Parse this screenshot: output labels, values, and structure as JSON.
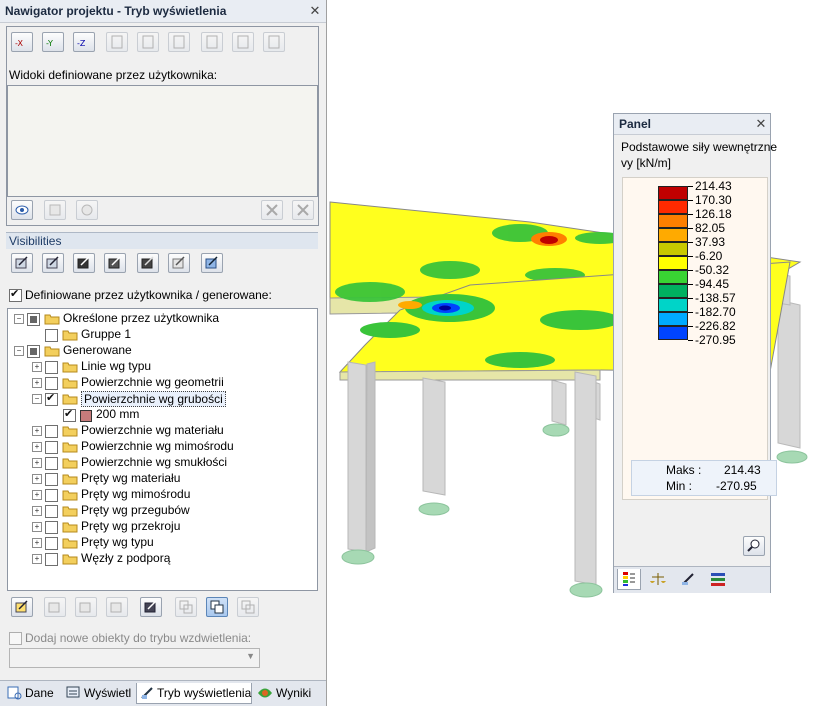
{
  "navigator": {
    "title": "Nawigator projektu - Tryb wyświetlenia",
    "views_label": "Widoki definiowane przez użytkownika:",
    "visibilities_header": "Visibilities",
    "user_generated_label": "Definiowane przez użytkownika / generowane:",
    "add_new_label": "Dodaj nowe obiekty do trybu wzdwietlenia:",
    "dropdown_value": "",
    "view_buttons": [
      "-X",
      "-Y",
      "-Z"
    ],
    "tree": [
      {
        "label": "Określone przez użytkownika",
        "level": 0,
        "check": "part",
        "pm": "-"
      },
      {
        "label": "Gruppe 1",
        "level": 1,
        "check": "none",
        "pm": ""
      },
      {
        "label": "Generowane",
        "level": 0,
        "check": "part",
        "pm": "-"
      },
      {
        "label": "Linie wg typu",
        "level": 1,
        "check": "none",
        "pm": "+"
      },
      {
        "label": "Powierzchnie wg geometrii",
        "level": 1,
        "check": "none",
        "pm": "+"
      },
      {
        "label": "Powierzchnie wg grubości",
        "level": 1,
        "check": "chk",
        "pm": "-",
        "selected": true
      },
      {
        "label": "200 mm",
        "level": 2,
        "check": "chk",
        "pm": "",
        "swatch": "#c67b7b"
      },
      {
        "label": "Powierzchnie wg materiału",
        "level": 1,
        "check": "none",
        "pm": "+"
      },
      {
        "label": "Powierzchnie wg mimośrodu",
        "level": 1,
        "check": "none",
        "pm": "+"
      },
      {
        "label": "Powierzchnie wg smukłości",
        "level": 1,
        "check": "none",
        "pm": "+"
      },
      {
        "label": "Pręty wg materiału",
        "level": 1,
        "check": "none",
        "pm": "+"
      },
      {
        "label": "Pręty wg mimośrodu",
        "level": 1,
        "check": "none",
        "pm": "+"
      },
      {
        "label": "Pręty wg przegubów",
        "level": 1,
        "check": "none",
        "pm": "+"
      },
      {
        "label": "Pręty wg przekroju",
        "level": 1,
        "check": "none",
        "pm": "+"
      },
      {
        "label": "Pręty wg typu",
        "level": 1,
        "check": "none",
        "pm": "+"
      },
      {
        "label": "Węzły z podporą",
        "level": 1,
        "check": "none",
        "pm": "+"
      }
    ],
    "tabs": [
      "Dane",
      "Wyświetl",
      "Tryb wyświetlenia",
      "Wyniki"
    ],
    "active_tab": 2
  },
  "panel": {
    "title": "Panel",
    "subtitle": "Podstawowe siły wewnętrzne",
    "unit": "vy [kN/m]",
    "legend": [
      {
        "value": "214.43",
        "color": "#c00000"
      },
      {
        "value": "170.30",
        "color": "#ff2a00"
      },
      {
        "value": "126.18",
        "color": "#ff7f00"
      },
      {
        "value": "82.05",
        "color": "#ffaa00"
      },
      {
        "value": "37.93",
        "color": "#c8c800"
      },
      {
        "value": "-6.20",
        "color": "#ffff00"
      },
      {
        "value": "-50.32",
        "color": "#39d433"
      },
      {
        "value": "-94.45",
        "color": "#00b060"
      },
      {
        "value": "-138.57",
        "color": "#00d4c8"
      },
      {
        "value": "-182.70",
        "color": "#00aaff"
      },
      {
        "value": "-226.82",
        "color": "#0044ff"
      },
      {
        "value": "-270.95",
        "color": "#000099"
      }
    ],
    "max_label": "Maks :",
    "max_value": "214.43",
    "min_label": "Min   :",
    "min_value": "-270.95"
  }
}
